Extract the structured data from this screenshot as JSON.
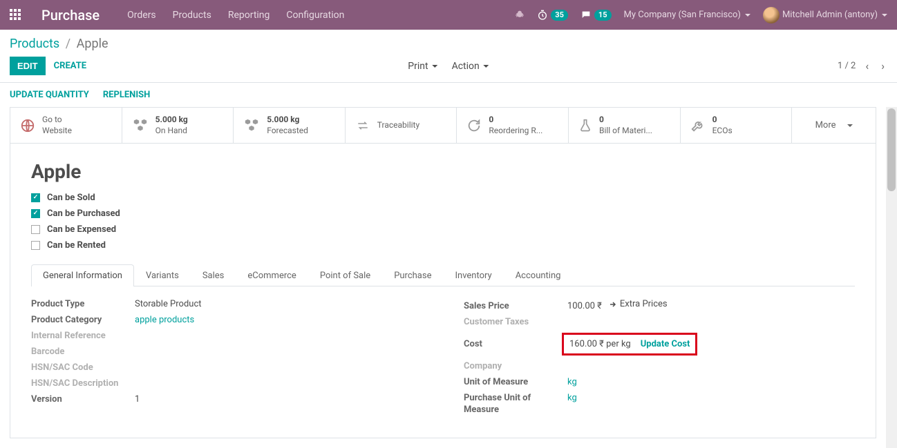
{
  "header": {
    "brand": "Purchase",
    "nav": {
      "orders": "Orders",
      "products": "Products",
      "reporting": "Reporting",
      "config": "Configuration"
    },
    "badge_timer": "35",
    "badge_msg": "15",
    "company": "My Company (San Francisco)",
    "user": "Mitchell Admin (antony)"
  },
  "breadcrumb": {
    "parent": "Products",
    "current": "Apple"
  },
  "controls": {
    "edit": "EDIT",
    "create": "CREATE",
    "print": "Print",
    "action": "Action",
    "pager": "1 / 2"
  },
  "sub": {
    "updateqty": "UPDATE QUANTITY",
    "replenish": "REPLENISH"
  },
  "stats": {
    "website": {
      "l1": "Go to",
      "l2": "Website"
    },
    "onhand": {
      "val": "5.000 kg",
      "l": "On Hand"
    },
    "forecast": {
      "val": "5.000 kg",
      "l": "Forecasted"
    },
    "trace": {
      "l": "Traceability"
    },
    "reorder": {
      "val": "0",
      "l": "Reordering R..."
    },
    "bom": {
      "val": "0",
      "l": "Bill of Materi..."
    },
    "eco": {
      "val": "0",
      "l": "ECOs"
    },
    "more": "More"
  },
  "product": {
    "title": "Apple",
    "checks": {
      "sold": "Can be Sold",
      "purchased": "Can be Purchased",
      "expensed": "Can be Expensed",
      "rented": "Can be Rented"
    }
  },
  "tabs": {
    "gen": "General Information",
    "var": "Variants",
    "sales": "Sales",
    "ecom": "eCommerce",
    "pos": "Point of Sale",
    "purchase": "Purchase",
    "inv": "Inventory",
    "acc": "Accounting"
  },
  "fields": {
    "left": {
      "ptype_l": "Product Type",
      "ptype_v": "Storable Product",
      "pcat_l": "Product Category",
      "pcat_v": "apple products",
      "iref_l": "Internal Reference",
      "barcode_l": "Barcode",
      "hsn_l": "HSN/SAC Code",
      "hsnd_l": "HSN/SAC Description",
      "ver_l": "Version",
      "ver_v": "1"
    },
    "right": {
      "sprice_l": "Sales Price",
      "sprice_v": "100.00 ₹",
      "extra": "Extra Prices",
      "ctax_l": "Customer Taxes",
      "cost_l": "Cost",
      "cost_v": "160.00 ₹ per kg",
      "update_cost": "Update Cost",
      "company_l": "Company",
      "uom_l": "Unit of Measure",
      "uom_v": "kg",
      "puom_l": "Purchase Unit of Measure",
      "puom_v": "kg"
    }
  }
}
